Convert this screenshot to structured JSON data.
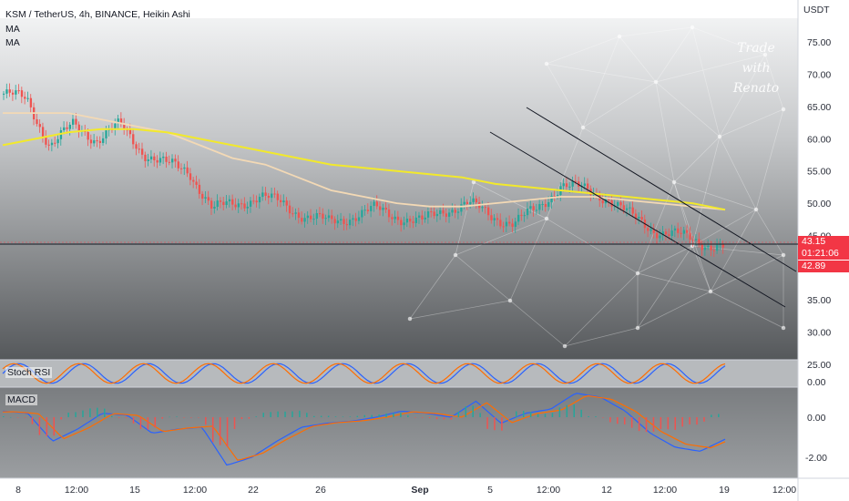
{
  "header": {
    "symbol_line": "KSM / TetherUS, 4h, BINANCE, Heikin Ashi",
    "indicator_1": "MA",
    "indicator_2": "MA"
  },
  "watermark": {
    "line1": "Trade",
    "line2": "with",
    "line3": "Renato"
  },
  "price_axis": {
    "unit": "USDT",
    "ticks": [
      "75.00",
      "70.00",
      "65.00",
      "60.00",
      "55.00",
      "50.00",
      "45.00",
      "35.00",
      "30.00",
      "25.00"
    ]
  },
  "tags": {
    "last_price": "43.15",
    "countdown": "01:21:06",
    "line_price": "42.89"
  },
  "stoch_pane": {
    "label": "Stoch RSI",
    "tick": "0.00"
  },
  "macd_pane": {
    "label": "MACD",
    "ticks": [
      "0.00",
      "-2.00"
    ]
  },
  "time_axis": {
    "labels": [
      "8",
      "12:00",
      "15",
      "12:00",
      "22",
      "26",
      "Sep",
      "5",
      "12:00",
      "12",
      "12:00",
      "19",
      "12:00"
    ]
  },
  "colors": {
    "up": "#26a69a",
    "down": "#ef5350",
    "ma_fast": "#f3d9b5",
    "ma_slow": "#f2e92b",
    "stoch_k": "#2962ff",
    "stoch_d": "#ff6d00",
    "price_tag": "#f23645"
  },
  "chart_data": {
    "type": "candlestick",
    "title": "KSM / TetherUS, 4h, BINANCE, Heikin Ashi",
    "ylabel": "USDT",
    "ylim": [
      25,
      78
    ],
    "x_labels": [
      "8",
      "12:00",
      "15",
      "12:00",
      "22",
      "26",
      "Sep",
      "5",
      "12:00",
      "12",
      "12:00",
      "19",
      "12:00"
    ],
    "series": [
      {
        "name": "MA",
        "values_approx": [
          64,
          64,
          64,
          63,
          62,
          61,
          59,
          57,
          56,
          54,
          52,
          51,
          50,
          49.5,
          49.5,
          50,
          50.5,
          51,
          51,
          50.5,
          50,
          49.5,
          49
        ]
      },
      {
        "name": "MA",
        "values_approx": [
          59,
          60,
          61,
          61.5,
          61.5,
          61,
          60,
          59,
          58,
          57,
          56,
          55.5,
          55,
          54.5,
          54,
          53,
          52.5,
          52,
          51.5,
          51,
          50.5,
          50,
          49
        ]
      }
    ],
    "price_path_approx": [
      67,
      66,
      59,
      62,
      60,
      62,
      58,
      56,
      55,
      49,
      50,
      51,
      50,
      48,
      47,
      48,
      49,
      48,
      47,
      49,
      50,
      48,
      47,
      49,
      53,
      52,
      51,
      48,
      46,
      45,
      44,
      43.2
    ],
    "horizontal_line": 42.89,
    "last_price": 43.15,
    "descending_channel": true
  }
}
